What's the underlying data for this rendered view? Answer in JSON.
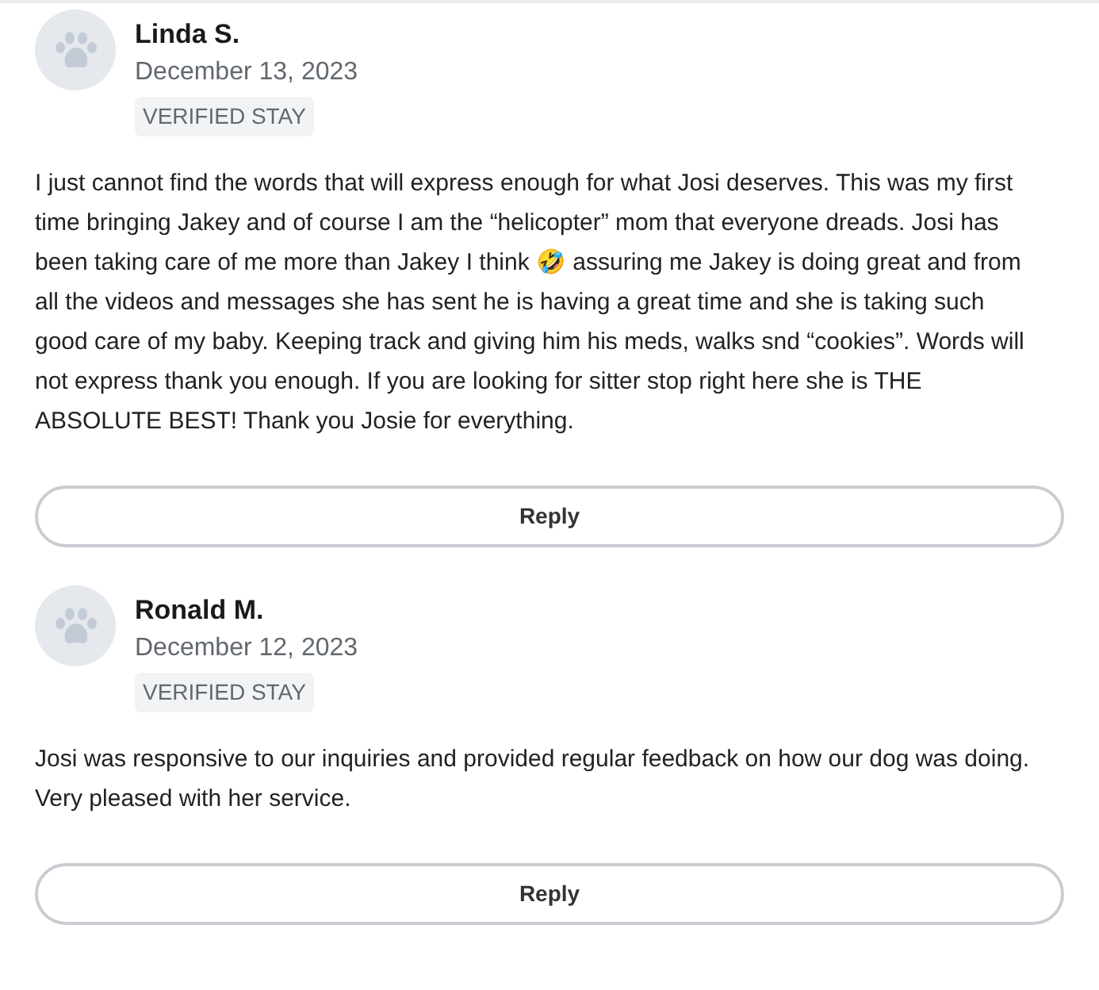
{
  "reviews": [
    {
      "name": "Linda S.",
      "date": "December 13, 2023",
      "badge": "VERIFIED STAY",
      "text": "I just cannot find the words that will express enough for what Josi deserves. This was my first time bringing Jakey and of course I am the “helicopter” mom that everyone dreads. Josi has been taking care of me more than Jakey I think 🤣 assuring me Jakey is doing great and from all the videos and messages she has sent he is having a great time and she is taking such good care of my baby. Keeping track and giving him his meds, walks snd “cookies”. Words will not express thank you enough. If you are looking for sitter stop right here she is THE ABSOLUTE BEST! Thank you Josie for everything.",
      "reply_button": "Reply"
    },
    {
      "name": "Ronald M.",
      "date": "December 12, 2023",
      "badge": "VERIFIED STAY",
      "text": "Josi was responsive to our inquiries and provided regular feedback on how our dog was doing.  Very pleased with her service.",
      "reply_button": "Reply"
    }
  ]
}
